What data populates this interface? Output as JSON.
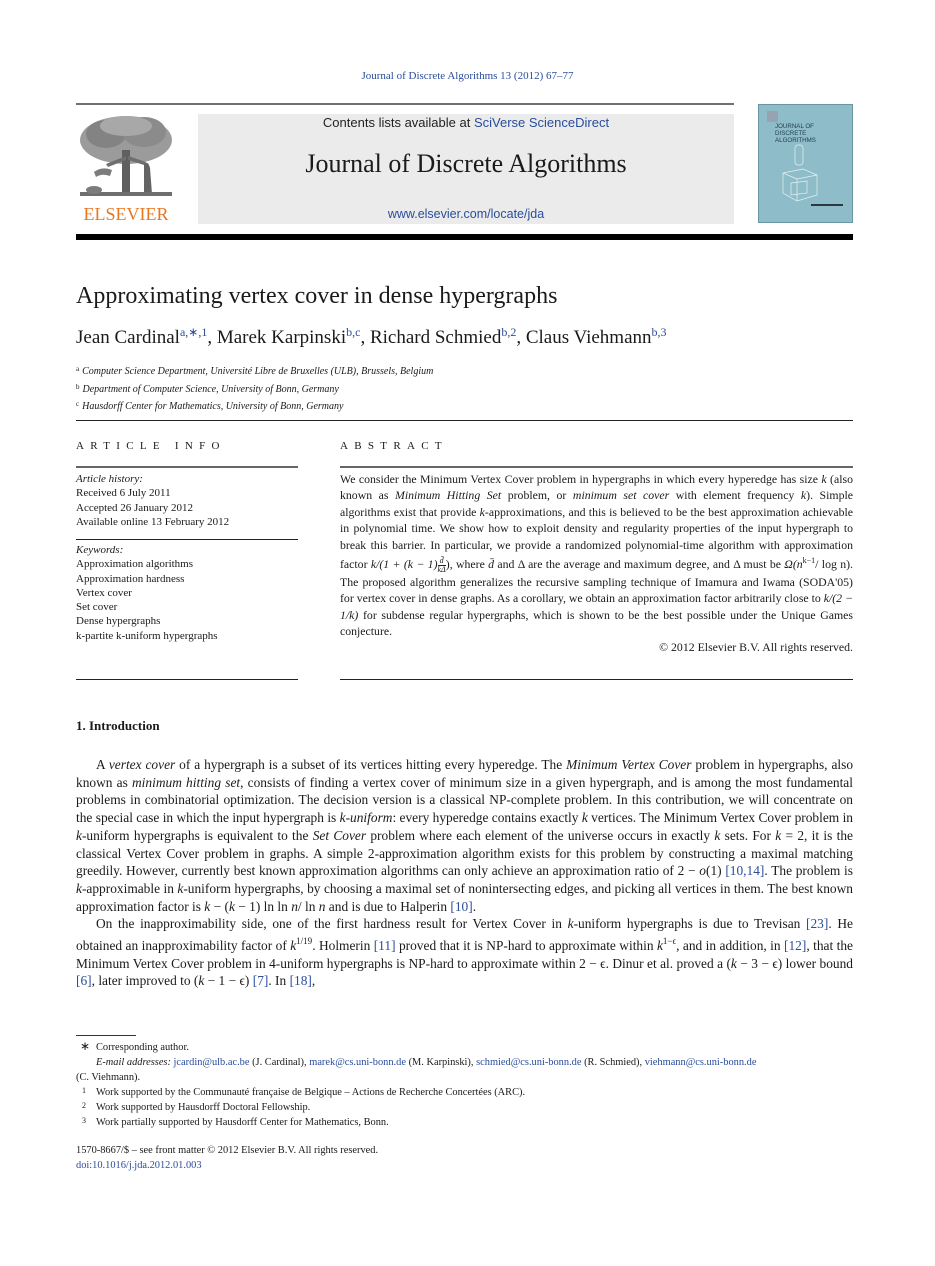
{
  "header": {
    "journal_reference": "Journal of Discrete Algorithms 13 (2012) 67–77",
    "contents_prefix": "Contents lists available at ",
    "contents_link": "SciVerse ScienceDirect",
    "journal_title": "Journal of Discrete Algorithms",
    "journal_url": "www.elsevier.com/locate/jda",
    "publisher_logo_text": "ELSEVIER",
    "cover_title_lines": [
      "JOURNAL OF",
      "DISCRETE",
      "ALGORITHMS"
    ]
  },
  "colors": {
    "link": "#2a4d9b",
    "elsevier_orange": "#e87722",
    "cover_blue": "#8fbcc9",
    "banner_gray": "#ebebeb"
  },
  "article": {
    "title": "Approximating vertex cover in dense hypergraphs",
    "authors": [
      {
        "name": "Jean Cardinal",
        "marks": "a,∗,1",
        "sep": ", "
      },
      {
        "name": "Marek Karpinski",
        "marks": "b,c",
        "sep": ", "
      },
      {
        "name": "Richard Schmied",
        "marks": "b,2",
        "sep": ", "
      },
      {
        "name": "Claus Viehmann",
        "marks": "b,3",
        "sep": ""
      }
    ],
    "affiliations": [
      {
        "mark": "a",
        "text": "Computer Science Department, Université Libre de Bruxelles (ULB), Brussels, Belgium"
      },
      {
        "mark": "b",
        "text": "Department of Computer Science, University of Bonn, Germany"
      },
      {
        "mark": "c",
        "text": "Hausdorff Center for Mathematics, University of Bonn, Germany"
      }
    ]
  },
  "article_info": {
    "heading": "ARTICLE INFO",
    "history_label": "Article history:",
    "history": [
      "Received 6 July 2011",
      "Accepted 26 January 2012",
      "Available online 13 February 2012"
    ],
    "keywords_label": "Keywords:",
    "keywords": [
      "Approximation algorithms",
      "Approximation hardness",
      "Vertex cover",
      "Set cover",
      "Dense hypergraphs",
      "k-partite k-uniform hypergraphs"
    ]
  },
  "abstract": {
    "heading": "ABSTRACT",
    "part1": "We consider the Minimum Vertex Cover problem in hypergraphs in which every hyperedge has size ",
    "k": "k",
    "part2": " (also known as ",
    "it1": "Minimum Hitting Set",
    "part3": " problem, or ",
    "it2": "minimum set cover",
    "part4": " with element frequency ",
    "part5": "). Simple algorithms exist that provide ",
    "part6": "-approximations, and this is believed to be the best approximation achievable in polynomial time. We show how to exploit density and regularity properties of the input hypergraph to break this barrier. In particular, we provide a randomized polynomial-time algorithm with approximation factor ",
    "formula1_prefix": "k/(1 + (k − 1)",
    "formula1_num": "d̄",
    "formula1_den": "kΔ",
    "formula1_suffix": ")",
    "part7": ", where ",
    "dbar": "d̄",
    "part8": " and Δ are the average and maximum degree, and Δ must be ",
    "formula2": "Ω(n",
    "formula2_exp": "k−1",
    "formula2_tail": "/ log n)",
    "part9": ". The proposed algorithm generalizes the recursive sampling technique of Imamura and Iwama (SODA'05) for vertex cover in dense graphs. As a corollary, we obtain an approximation factor arbitrarily close to ",
    "formula3": "k/(2 − 1/k)",
    "part10": " for subdense regular hypergraphs, which is shown to be the best possible under the Unique Games conjecture.",
    "copyright": "© 2012 Elsevier B.V. All rights reserved."
  },
  "introduction": {
    "heading": "1. Introduction",
    "p1": [
      {
        "t": "A "
      },
      {
        "i": "vertex cover"
      },
      {
        "t": " of a hypergraph is a subset of its vertices hitting every hyperedge. The "
      },
      {
        "i": "Minimum Vertex Cover"
      },
      {
        "t": " problem in hypergraphs, also known as "
      },
      {
        "i": "minimum hitting set"
      },
      {
        "t": ", consists of finding a vertex cover of minimum size in a given hypergraph, and is among the most fundamental problems in combinatorial optimization. The decision version is a classical NP-complete problem. In this contribution, we will concentrate on the special case in which the input hypergraph is "
      },
      {
        "i": "k-uniform"
      },
      {
        "t": ": every hyperedge contains exactly "
      },
      {
        "i": "k"
      },
      {
        "t": " vertices. The Minimum Vertex Cover problem in "
      },
      {
        "i": "k"
      },
      {
        "t": "-uniform hypergraphs is equivalent to the "
      },
      {
        "i": "Set Cover"
      },
      {
        "t": " problem where each element of the universe occurs in exactly "
      },
      {
        "i": "k"
      },
      {
        "t": " sets. For "
      },
      {
        "i": "k"
      },
      {
        "t": " = 2, it is the classical Vertex Cover problem in graphs. A simple 2-approximation algorithm exists for this problem by constructing a maximal matching greedily. However, currently best known approximation algorithms can only achieve an approximation ratio of 2 − "
      },
      {
        "i": "o"
      },
      {
        "t": "(1) "
      },
      {
        "a": "[10,14]"
      },
      {
        "t": ". The problem is "
      },
      {
        "i": "k"
      },
      {
        "t": "-approximable in "
      },
      {
        "i": "k"
      },
      {
        "t": "-uniform hypergraphs, by choosing a maximal set of nonintersecting edges, and picking all vertices in them. The best known approximation factor is "
      },
      {
        "i": "k"
      },
      {
        "t": " − ("
      },
      {
        "i": "k"
      },
      {
        "t": " − 1) ln ln "
      },
      {
        "i": "n"
      },
      {
        "t": "/ ln "
      },
      {
        "i": "n"
      },
      {
        "t": " and is due to Halperin "
      },
      {
        "a": "[10]"
      },
      {
        "t": "."
      }
    ],
    "p2": [
      {
        "t": "On the inapproximability side, one of the first hardness result for Vertex Cover in "
      },
      {
        "i": "k"
      },
      {
        "t": "-uniform hypergraphs is due to Trevisan "
      },
      {
        "a": "[23]"
      },
      {
        "t": ". He obtained an inapproximability factor of "
      },
      {
        "i": "k"
      },
      {
        "s": "1/19"
      },
      {
        "t": ". Holmerin "
      },
      {
        "a": "[11]"
      },
      {
        "t": " proved that it is NP-hard to approximate within "
      },
      {
        "i": "k"
      },
      {
        "s": "1−ϵ"
      },
      {
        "t": ", and in addition, in "
      },
      {
        "a": "[12]"
      },
      {
        "t": ", that the Minimum Vertex Cover problem in 4-uniform hypergraphs is NP-hard to approximate within 2 − ϵ. Dinur et al. proved a ("
      },
      {
        "i": "k"
      },
      {
        "t": " − 3 − ϵ) lower bound "
      },
      {
        "a": "[6]"
      },
      {
        "t": ", later improved to ("
      },
      {
        "i": "k"
      },
      {
        "t": " − 1 − ϵ) "
      },
      {
        "a": "[7]"
      },
      {
        "t": ". In "
      },
      {
        "a": "[18]"
      },
      {
        "t": ","
      }
    ]
  },
  "footnotes": {
    "corresponding_mark": "∗",
    "corresponding": "Corresponding author.",
    "email_label": "E-mail addresses:",
    "emails": [
      {
        "addr": "jcardin@ulb.ac.be",
        "who": "(J. Cardinal)"
      },
      {
        "addr": "marek@cs.uni-bonn.de",
        "who": "(M. Karpinski)"
      },
      {
        "addr": "schmied@cs.uni-bonn.de",
        "who": "(R. Schmied)"
      },
      {
        "addr": "viehmann@cs.uni-bonn.de",
        "who": "(C. Viehmann)."
      }
    ],
    "notes": [
      {
        "mark": "1",
        "text": "Work supported by the Communauté française de Belgique – Actions de Recherche Concertées (ARC)."
      },
      {
        "mark": "2",
        "text": "Work supported by Hausdorff Doctoral Fellowship."
      },
      {
        "mark": "3",
        "text": "Work partially supported by Hausdorff Center for Mathematics, Bonn."
      }
    ]
  },
  "footer": {
    "issn_line": "1570-8667/$ – see front matter  © 2012 Elsevier B.V. All rights reserved.",
    "doi": "doi:10.1016/j.jda.2012.01.003"
  }
}
